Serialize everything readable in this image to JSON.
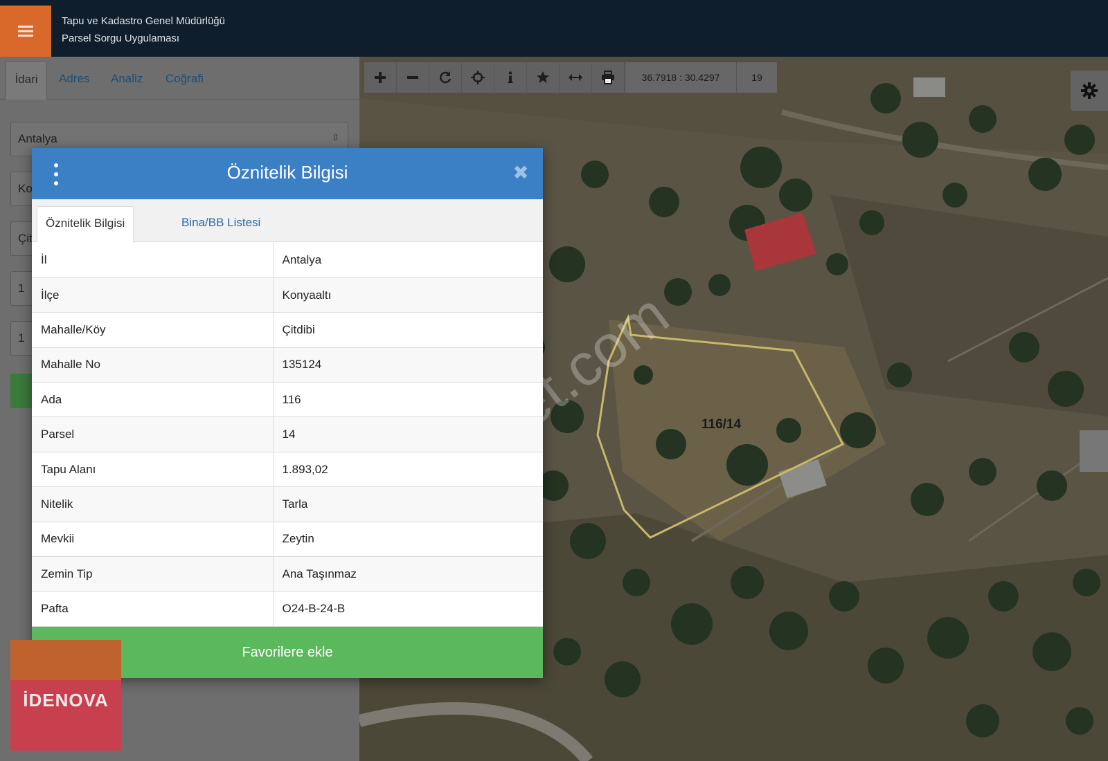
{
  "header": {
    "line1": "Tapu ve Kadastro Genel Müdürlüğü",
    "line2": "Parsel Sorgu Uygulaması",
    "menu_icon": "hamburger-icon"
  },
  "left_panel": {
    "tabs": [
      "İdari",
      "Adres",
      "Analiz",
      "Coğrafi"
    ],
    "province_select": "Antalya",
    "field_district": "Ko",
    "field_neighborhood": "Çit",
    "field_block": "1",
    "field_parcel": "1"
  },
  "map_toolbar": {
    "coordinates": "36.7918 : 30.4297",
    "zoom_level": "19"
  },
  "map": {
    "parcel_label": "116/14"
  },
  "modal": {
    "title": "Öznitelik Bilgisi",
    "tabs": [
      "Öznitelik Bilgisi",
      "Bina/BB Listesi"
    ],
    "rows": [
      {
        "key": "İl",
        "value": "Antalya"
      },
      {
        "key": "İlçe",
        "value": "Konyaaltı"
      },
      {
        "key": "Mahalle/Köy",
        "value": "Çitdibi"
      },
      {
        "key": "Mahalle No",
        "value": "135124"
      },
      {
        "key": "Ada",
        "value": "116"
      },
      {
        "key": "Parsel",
        "value": "14"
      },
      {
        "key": "Tapu Alanı",
        "value": "1.893,02"
      },
      {
        "key": "Nitelik",
        "value": "Tarla"
      },
      {
        "key": "Mevkii",
        "value": "Zeytin"
      },
      {
        "key": "Zemin Tip",
        "value": "Ana Taşınmaz"
      },
      {
        "key": "Pafta",
        "value": "O24-B-24-B"
      }
    ],
    "favorite_button": "Favorilere ekle"
  },
  "logo_text": "İDENOVA",
  "watermark": "emlakjet.com",
  "colors": {
    "header_bg": "#0f1e2c",
    "menu_accent": "#d9692a",
    "modal_header": "#3b7fc4",
    "favorite_green": "#5cb85c",
    "parcel_outline": "#c8b86a"
  }
}
